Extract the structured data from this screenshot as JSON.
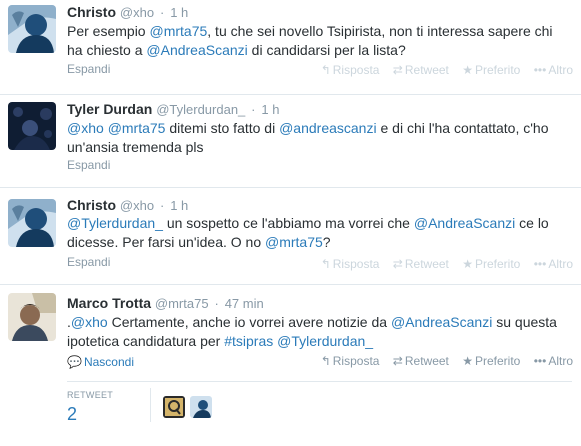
{
  "tweets": [
    {
      "name": "Christo",
      "handle": "@xho",
      "dot": "·",
      "time": "1 h",
      "text_parts": [
        {
          "t": "Per esempio ",
          "k": "text"
        },
        {
          "t": "@mrta75",
          "k": "mention"
        },
        {
          "t": ", tu che sei novello Tsipirista, non ti interessa sapere chi ha chiesto a ",
          "k": "text"
        },
        {
          "t": "@AndreaScanzi",
          "k": "mention"
        },
        {
          "t": " di candidarsi per la lista?",
          "k": "text"
        }
      ],
      "expand": "Espandi",
      "avatar_icon": "christo-avatar"
    },
    {
      "name": "Tyler Durdan",
      "handle": "@Tylerdurdan_",
      "dot": "·",
      "time": "1 h",
      "text_parts": [
        {
          "t": "@xho",
          "k": "mention"
        },
        {
          "t": " ",
          "k": "text"
        },
        {
          "t": "@mrta75",
          "k": "mention"
        },
        {
          "t": " ditemi sto fatto di ",
          "k": "text"
        },
        {
          "t": "@andreascanzi",
          "k": "mention"
        },
        {
          "t": " e  di chi l'ha contattato, c'ho un'ansia tremenda pls",
          "k": "text"
        }
      ],
      "expand": "Espandi",
      "avatar_icon": "tyler-avatar"
    },
    {
      "name": "Christo",
      "handle": "@xho",
      "dot": "·",
      "time": "1 h",
      "text_parts": [
        {
          "t": "@Tylerdurdan_",
          "k": "mention"
        },
        {
          "t": "  un sospetto ce l'abbiamo ma vorrei che ",
          "k": "text"
        },
        {
          "t": "@AndreaScanzi",
          "k": "mention"
        },
        {
          "t": " ce lo dicesse. Per farsi un'idea. O no ",
          "k": "text"
        },
        {
          "t": "@mrta75",
          "k": "mention"
        },
        {
          "t": "?",
          "k": "text"
        }
      ],
      "expand": "Espandi",
      "avatar_icon": "christo-avatar"
    },
    {
      "name": "Marco Trotta",
      "handle": "@mrta75",
      "dot": "·",
      "time": "47 min",
      "text_parts": [
        {
          "t": ".",
          "k": "text"
        },
        {
          "t": "@xho",
          "k": "mention"
        },
        {
          "t": " Certamente, anche io vorrei avere notizie da ",
          "k": "text"
        },
        {
          "t": "@AndreaScanzi",
          "k": "mention"
        },
        {
          "t": " su questa ipotetica candidatura per ",
          "k": "text"
        },
        {
          "t": "#tsipras",
          "k": "hashtag"
        },
        {
          "t": " ",
          "k": "text"
        },
        {
          "t": "@Tylerdurdan_",
          "k": "mention"
        }
      ],
      "collapse": "Nascondi",
      "avatar_icon": "marco-avatar"
    }
  ],
  "actions": {
    "reply": "Risposta",
    "retweet": "Retweet",
    "favorite": "Preferito",
    "more": "Altro"
  },
  "stats": {
    "retweet_label": "RETWEET",
    "retweet_count": "2"
  },
  "colors": {
    "link": "#2b7bb9",
    "muted": "#8899a6",
    "text": "#292f33",
    "border": "#e1e8ed"
  }
}
